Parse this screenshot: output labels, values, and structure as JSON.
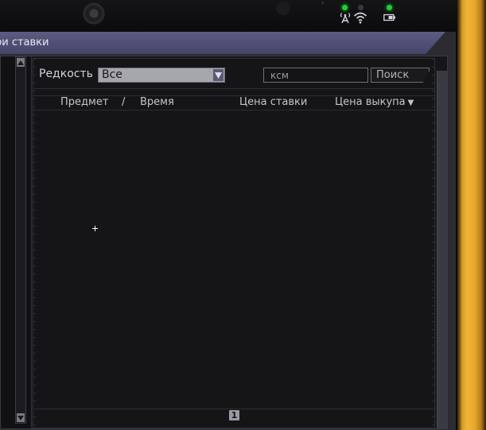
{
  "device": {
    "status_icons": [
      "antenna-icon",
      "wifi-icon",
      "battery-icon"
    ],
    "led_color": "#1fcf35"
  },
  "window": {
    "title": "ри ставки",
    "title_bar_color": "#4f4f76"
  },
  "filters": {
    "rarity_label": "Редкость",
    "rarity_value": "Все",
    "search_value": "ксм",
    "search_button": "Поиск"
  },
  "table": {
    "columns": {
      "item": "Предмет",
      "divider": "/",
      "time": "Время",
      "bid_price": "Цена ставки",
      "buyout_price": "Цена выкупа",
      "sort_indicator": "▼"
    },
    "rows": []
  },
  "pagination": {
    "current_page": "1"
  },
  "scrollbar": {
    "up_icon": "arrow-up-icon",
    "down_icon": "arrow-down-icon"
  }
}
